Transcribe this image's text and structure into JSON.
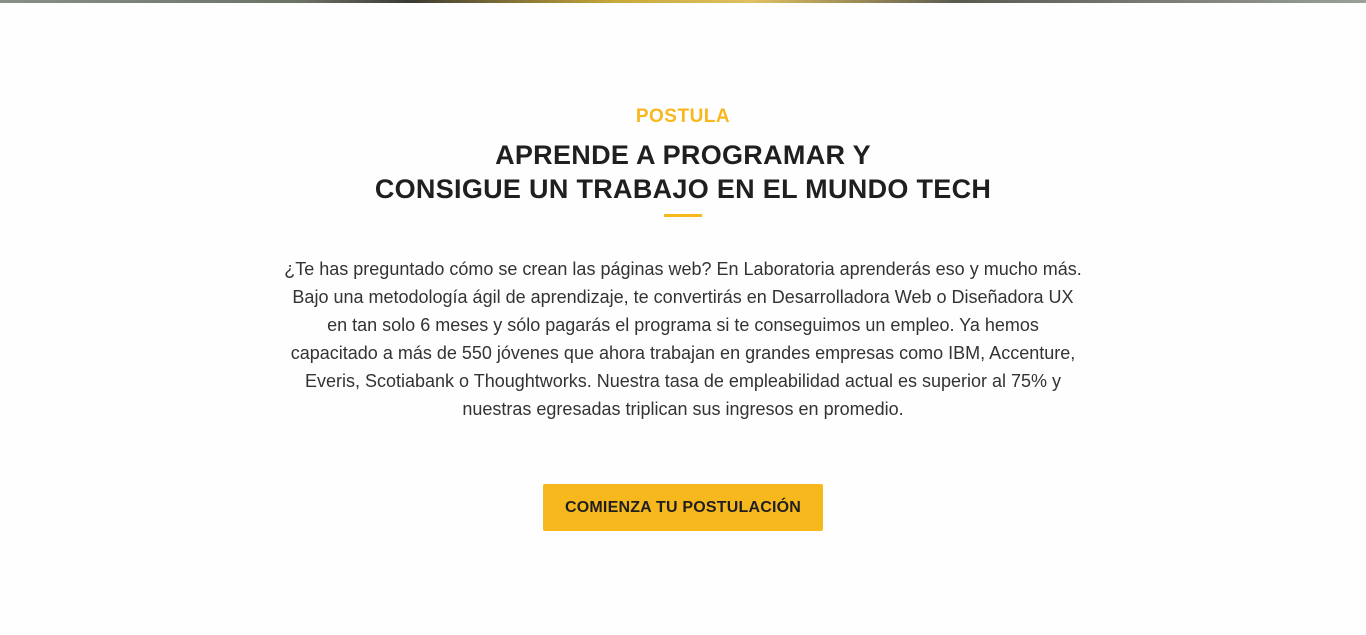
{
  "section": {
    "eyebrow": "POSTULA",
    "title_line1": "APRENDE A PROGRAMAR Y",
    "title_line2": "CONSIGUE UN TRABAJO EN EL MUNDO TECH",
    "body": "¿Te has preguntado cómo se crean las páginas web? En Laboratoria aprenderás eso y mucho más. Bajo una metodología ágil de aprendizaje, te convertirás en Desarrolladora Web o Diseñadora UX en tan solo 6 meses y sólo pagarás el programa si te conseguimos un empleo. Ya hemos capacitado a más de 550 jóvenes que ahora trabajan en grandes empresas como IBM, Accenture, Everis, Scotiabank o Thoughtworks. Nuestra tasa de empleabilidad actual es superior al 75% y nuestras egresadas triplican sus ingresos en promedio.",
    "cta_label": "COMIENZA TU POSTULACIÓN"
  },
  "colors": {
    "accent": "#f7b81e",
    "heading": "#1f1f1f",
    "text": "#333333",
    "background": "#fefefe"
  }
}
